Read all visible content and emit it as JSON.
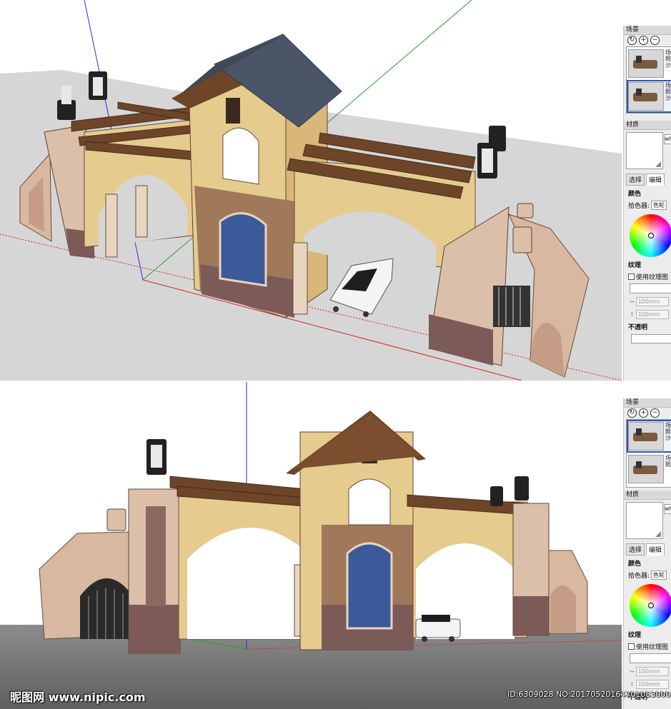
{
  "scene_panel": {
    "title": "场景",
    "buttons": [
      {
        "name": "refresh",
        "glyph": "↻"
      },
      {
        "name": "add",
        "glyph": "+"
      },
      {
        "name": "remove",
        "glyph": "−"
      }
    ],
    "scene_items": [
      {
        "label": "场",
        "sub1": "照",
        "sub2": "沙"
      },
      {
        "label": "场",
        "sub1": "照",
        "sub2": "沙"
      }
    ]
  },
  "material_panel": {
    "title": "材质",
    "name_value": "wh",
    "tabs": [
      "选择",
      "编辑"
    ],
    "color_label": "颜色",
    "picker_label": "拾色器:",
    "picker_value": "色轮",
    "texture_label": "纹理",
    "use_texture_label": "使用纹理图",
    "width_value": "100mm",
    "height_value": "100mm",
    "opacity_label": "不透明"
  },
  "watermark": {
    "site": "昵图网 www.nipic.com",
    "id_text": "ID:6309028 NO:20170520164701083000"
  },
  "colors": {
    "stucco": "#e6cb8f",
    "stone": "#e8d5bf",
    "column_dark": "#7b5a57",
    "roof": "#4a5568",
    "timber": "#6e4529",
    "ground_top": "#d6d6d6",
    "ground_bottom": "#5f5f5f"
  }
}
